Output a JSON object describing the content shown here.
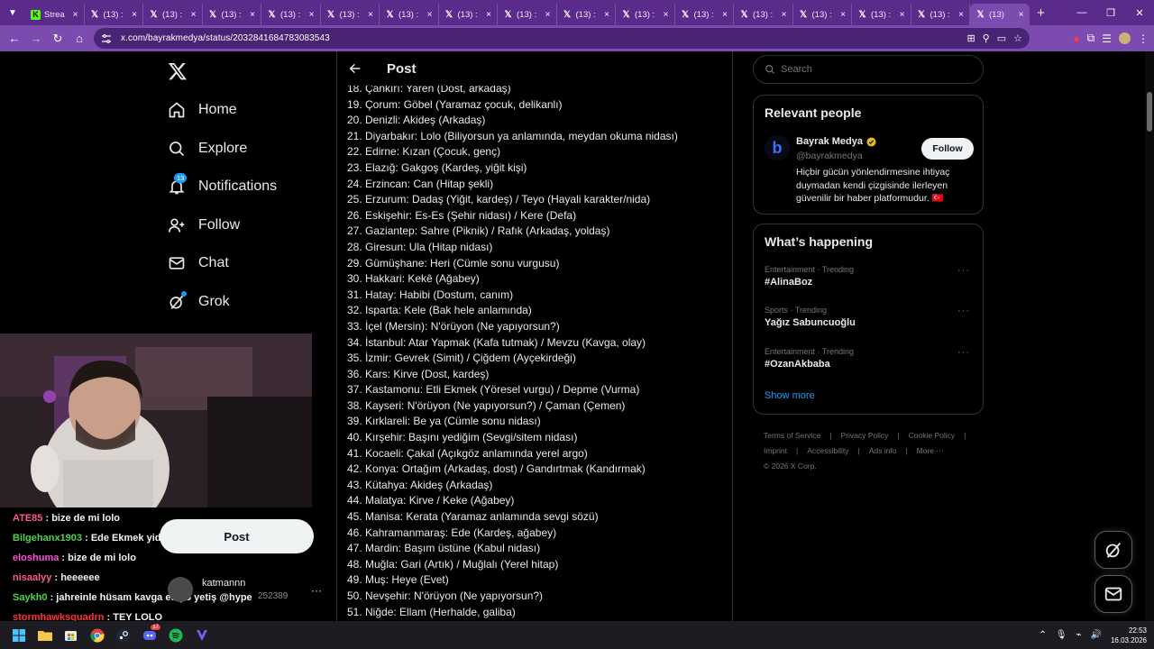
{
  "browser": {
    "tabs": [
      {
        "label": "Strea",
        "icon": "kick-icon",
        "active": false
      },
      {
        "label": "(13) :",
        "icon": "x-icon",
        "active": false
      },
      {
        "label": "(13) :",
        "icon": "x-icon",
        "active": false
      },
      {
        "label": "(13) :",
        "icon": "x-icon",
        "active": false
      },
      {
        "label": "(13) :",
        "icon": "x-icon",
        "active": false
      },
      {
        "label": "(13) :",
        "icon": "x-icon",
        "active": false
      },
      {
        "label": "(13) :",
        "icon": "x-icon",
        "active": false
      },
      {
        "label": "(13) :",
        "icon": "x-icon",
        "active": false
      },
      {
        "label": "(13) :",
        "icon": "x-icon",
        "active": false
      },
      {
        "label": "(13) :",
        "icon": "x-icon",
        "active": false
      },
      {
        "label": "(13) :",
        "icon": "x-icon",
        "active": false
      },
      {
        "label": "(13) :",
        "icon": "x-icon",
        "active": false
      },
      {
        "label": "(13) :",
        "icon": "x-icon",
        "active": false
      },
      {
        "label": "(13) :",
        "icon": "x-icon",
        "active": false
      },
      {
        "label": "(13) :",
        "icon": "x-icon",
        "active": false
      },
      {
        "label": "(13) :",
        "icon": "x-icon",
        "active": false
      },
      {
        "label": "(13)",
        "icon": "x-icon",
        "active": true
      }
    ],
    "url": "x.com/bayrakmedya/status/2032841684783083543",
    "theme_color": "#7b4bb0"
  },
  "nav": {
    "items": [
      {
        "label": "Home",
        "icon": "home-icon"
      },
      {
        "label": "Explore",
        "icon": "search-icon"
      },
      {
        "label": "Notifications",
        "icon": "bell-icon",
        "badge": "13"
      },
      {
        "label": "Follow",
        "icon": "follow-icon"
      },
      {
        "label": "Chat",
        "icon": "mail-icon"
      },
      {
        "label": "Grok",
        "icon": "grok-icon"
      }
    ],
    "post_button": "Post",
    "profile_name": "katmannn",
    "profile_more": "···"
  },
  "stream_chat": [
    {
      "user": "ATE85",
      "color": "#ff5a8a",
      "text": " : bize de mi lolo"
    },
    {
      "user": "Bilgehanx1903",
      "color": "#4fd14f",
      "text": " : Ede Ekmek yidi"
    },
    {
      "user": "eloshuma",
      "color": "#ff4fd8",
      "text": " : bize de mi lolo"
    },
    {
      "user": "nisaalyy",
      "color": "#ff5a8a",
      "text": " : heeeeee"
    },
    {
      "user": "Saykh0",
      "color": "#4fd14f",
      "text": " : jahreinle hüsam kavga ediyo yetiş @hype"
    },
    {
      "user": "stormhawksquadrn",
      "color": "#ff3333",
      "text": " : TEY LOLO"
    }
  ],
  "chat_fragment": "252389",
  "post": {
    "header": "Post",
    "lines": [
      "18. Çankırı: Yaren (Dost, arkadaş)",
      "19. Çorum: Göbel (Yaramaz çocuk, delikanlı)",
      "20. Denizli: Akideş (Arkadaş)",
      "21. Diyarbakır: Lolo (Biliyorsun ya anlamında, meydan okuma nidası)",
      "22. Edirne: Kızan (Çocuk, genç)",
      "23. Elazığ: Gakgoş (Kardeş, yiğit kişi)",
      "24. Erzincan: Can (Hitap şekli)",
      "25. Erzurum: Dadaş (Yiğit, kardeş) / Teyo (Hayali karakter/nida)",
      "26. Eskişehir: Es-Es (Şehir nidası) / Kere (Defa)",
      "27. Gaziantep: Sahre (Piknik) / Rafık (Arkadaş, yoldaş)",
      "28. Giresun: Ula (Hitap nidası)",
      "29. Gümüşhane: Heri (Cümle sonu vurgusu)",
      "30. Hakkari: Kekê (Ağabey)",
      "31. Hatay: Habibi (Dostum, canım)",
      "32. Isparta: Kele (Bak hele anlamında)",
      "33. İçel (Mersin): N'örüyon (Ne yapıyorsun?)",
      "34. İstanbul: Atar Yapmak (Kafa tutmak) / Mevzu (Kavga, olay)",
      "35. İzmir: Gevrek (Simit) / Çiğdem (Ayçekirdeği)",
      "36. Kars: Kirve (Dost, kardeş)",
      "37. Kastamonu: Etli Ekmek (Yöresel vurgu) / Depme (Vurma)",
      "38. Kayseri: N'örüyon (Ne yapıyorsun?) / Çaman (Çemen)",
      "39. Kırklareli: Be ya (Cümle sonu nidası)",
      "40. Kırşehir: Başını yediğim (Sevgi/sitem nidası)",
      "41. Kocaeli: Çakal (Açıkgöz anlamında yerel argo)",
      "42. Konya: Ortağım (Arkadaş, dost) / Gandırtmak (Kandırmak)",
      "43. Kütahya: Akideş (Arkadaş)",
      "44. Malatya: Kirve / Keke (Ağabey)",
      "45. Manisa: Kerata (Yaramaz anlamında sevgi sözü)",
      "46. Kahramanmaraş: Ede (Kardeş, ağabey)",
      "47. Mardin: Başım üstüne (Kabul nidası)",
      "48. Muğla: Gari (Artık) / Muğlalı (Yerel hitap)",
      "49. Muş: Heye (Evet)",
      "50. Nevşehir: N'örüyon (Ne yapıyorsun?)",
      "51. Niğde: Ellam (Herhalde, galiba)"
    ]
  },
  "right": {
    "search_placeholder": "Search",
    "relevant_title": "Relevant people",
    "person": {
      "name": "Bayrak Medya",
      "handle": "@bayrakmedya",
      "bio": "Hiçbir gücün yönlendirmesine ihtiyaç duymadan kendi çizgisinde ilerleyen güvenilir bir haber platformudur. 🇹🇷",
      "follow": "Follow",
      "logo_letter": "b"
    },
    "happening_title": "What’s happening",
    "trends": [
      {
        "meta": "Entertainment · Trending",
        "name": "#AlinaBoz"
      },
      {
        "meta": "Sports · Trending",
        "name": "Yağız Sabuncuoğlu"
      },
      {
        "meta": "Entertainment · Trending",
        "name": "#OzanAkbaba"
      }
    ],
    "trend_more": "···",
    "show_more": "Show more",
    "footer": [
      "Terms of Service",
      "|",
      "Privacy Policy",
      "|",
      "Cookie Policy",
      "|",
      "Imprint",
      "|",
      "Accessibility",
      "|",
      "Ads info",
      "|",
      "More ···",
      "© 2026 X Corp."
    ]
  },
  "taskbar": {
    "time": "22:53",
    "date": "16.03.2026",
    "mail_badge": "17"
  }
}
